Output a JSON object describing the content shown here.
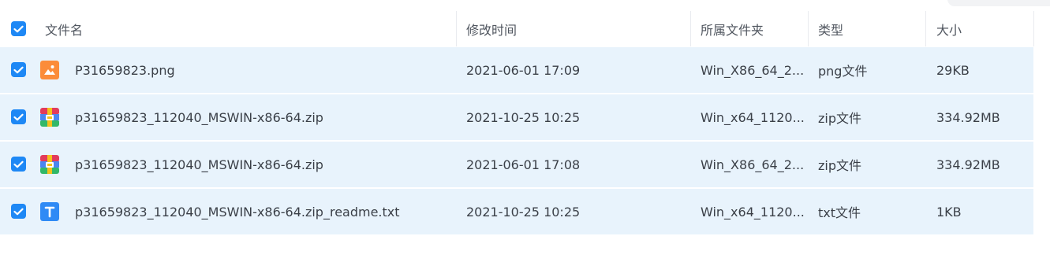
{
  "columns": {
    "name": "文件名",
    "modified": "修改时间",
    "folder": "所属文件夹",
    "type": "类型",
    "size": "大小"
  },
  "rows": [
    {
      "icon": "image-file-icon",
      "name": "P31659823.png",
      "modified": "2021-06-01 17:09",
      "folder": "Win_X86_64_2...",
      "type": "png文件",
      "size": "29KB",
      "checked": true
    },
    {
      "icon": "zip-archive-icon",
      "name": "p31659823_112040_MSWIN-x86-64.zip",
      "modified": "2021-10-25 10:25",
      "folder": "Win_x64_1120...",
      "type": "zip文件",
      "size": "334.92MB",
      "checked": true
    },
    {
      "icon": "zip-archive-icon",
      "name": "p31659823_112040_MSWIN-x86-64.zip",
      "modified": "2021-06-01 17:08",
      "folder": "Win_X86_64_2...",
      "type": "zip文件",
      "size": "334.92MB",
      "checked": true
    },
    {
      "icon": "text-file-icon",
      "name": "p31659823_112040_MSWIN-x86-64.zip_readme.txt",
      "modified": "2021-10-25 10:25",
      "folder": "Win_x64_1120...",
      "type": "txt文件",
      "size": "1KB",
      "checked": true
    }
  ],
  "colors": {
    "accent": "#1e88f5",
    "row_selected_bg": "#e8f3fc",
    "image_icon": "#fb8c3a",
    "text_icon": "#2f8af5"
  }
}
